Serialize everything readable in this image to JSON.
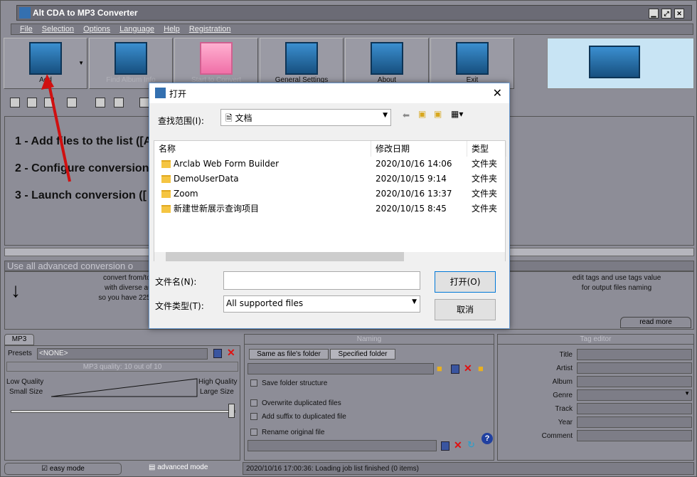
{
  "app": {
    "title": "Alt CDA to MP3 Converter"
  },
  "menu": [
    "File",
    "Selection",
    "Options",
    "Language",
    "Help",
    "Registration"
  ],
  "toolbar": [
    {
      "label": "Add",
      "icon": "add-files-icon",
      "enabled": true
    },
    {
      "label": "Find Album Info",
      "icon": "find-album-icon",
      "enabled": false
    },
    {
      "label": "Start to Convert",
      "icon": "convert-icon",
      "enabled": false
    },
    {
      "label": "General Settings",
      "icon": "settings-icon",
      "enabled": true
    },
    {
      "label": "About",
      "icon": "about-icon",
      "enabled": true
    },
    {
      "label": "Exit",
      "icon": "exit-icon",
      "enabled": true
    }
  ],
  "steps": [
    "1 - Add files to the list ([Add",
    "2 - Configure conversion",
    "3 - Launch conversion (["
  ],
  "banner": "Use all advanced conversion o",
  "info": {
    "left": [
      "convert from/to 15(",
      "with diverse audio",
      "so you have 225 conv"
    ],
    "right": [
      "edit tags and use tags value",
      "for output files naming"
    ],
    "read_more": "read more"
  },
  "mp3": {
    "tab": "MP3",
    "presets_label": "Presets",
    "preset": "<NONE>",
    "quality": "MP3 quality: 10 out of 10",
    "quality_value": 10,
    "quality_max": 10,
    "low1": "Low Quality",
    "low2": "Small Size",
    "high1": "High Quality",
    "high2": "Large Size"
  },
  "naming": {
    "header": "Naming",
    "tab1": "Same as file's folder",
    "tab2": "Specified folder",
    "save_structure": "Save folder structure",
    "overwrite": "Overwrite duplicated files",
    "suffix": "Add suffix to duplicated file",
    "rename": "Rename original file"
  },
  "tags": {
    "header": "Tag editor",
    "fields": [
      "Title",
      "Artist",
      "Album",
      "Genre",
      "Track",
      "Year",
      "Comment"
    ]
  },
  "status": {
    "easy": "easy mode",
    "advanced": "advanced mode",
    "message": "2020/10/16 17:00:36: Loading job list finished (0 items)"
  },
  "dialog": {
    "title": "打开",
    "lookin_label": "查找范围(I):",
    "lookin_value": "文档",
    "columns": [
      "名称",
      "修改日期",
      "类型"
    ],
    "rows": [
      {
        "name": "Arclab Web Form Builder",
        "date": "2020/10/16 14:06",
        "type": "文件夹"
      },
      {
        "name": "DemoUserData",
        "date": "2020/10/15 9:14",
        "type": "文件夹"
      },
      {
        "name": "Zoom",
        "date": "2020/10/16 13:37",
        "type": "文件夹"
      },
      {
        "name": "新建世新展示查询项目",
        "date": "2020/10/15 8:45",
        "type": "文件夹"
      }
    ],
    "filename_label": "文件名(N):",
    "filename_value": "",
    "filetype_label": "文件类型(T):",
    "filetype_value": "All supported files",
    "open": "打开(O)",
    "cancel": "取消"
  }
}
